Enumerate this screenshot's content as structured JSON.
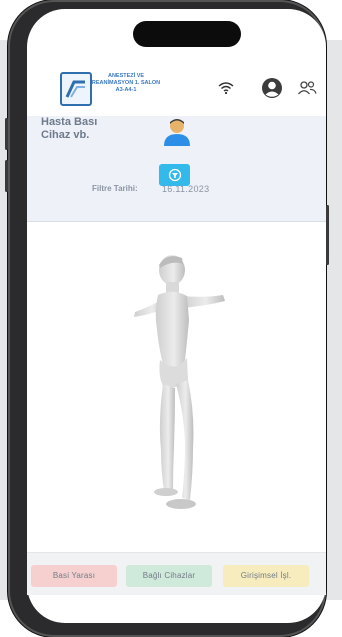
{
  "header": {
    "logo_title": "ANESTEZİ VE REANİMASYON 1. SALON A3-A4-1",
    "icons": {
      "wifi": "wifi-icon",
      "account": "account-circle-icon",
      "users": "users-icon"
    }
  },
  "panel": {
    "title": "Hasta Bası\nCihaz vb.",
    "patient_icon": "patient-icon",
    "filter_icon": "filter-icon",
    "filter_label": "Filtre Tarihi:",
    "filter_date": "16.11.2023"
  },
  "viewer": {
    "model": "3d-human-body-model"
  },
  "tabs": [
    {
      "label": "Basi Yarası",
      "color": "#f6d0cf"
    },
    {
      "label": "Bağlı Cihazlar",
      "color": "#cfe9da"
    },
    {
      "label": "Girişimsel İşl.",
      "color": "#f6ecbe"
    }
  ],
  "colors": {
    "accent": "#33b9ea",
    "brand": "#2f6fb0",
    "patient_icon": "#f5a623"
  }
}
